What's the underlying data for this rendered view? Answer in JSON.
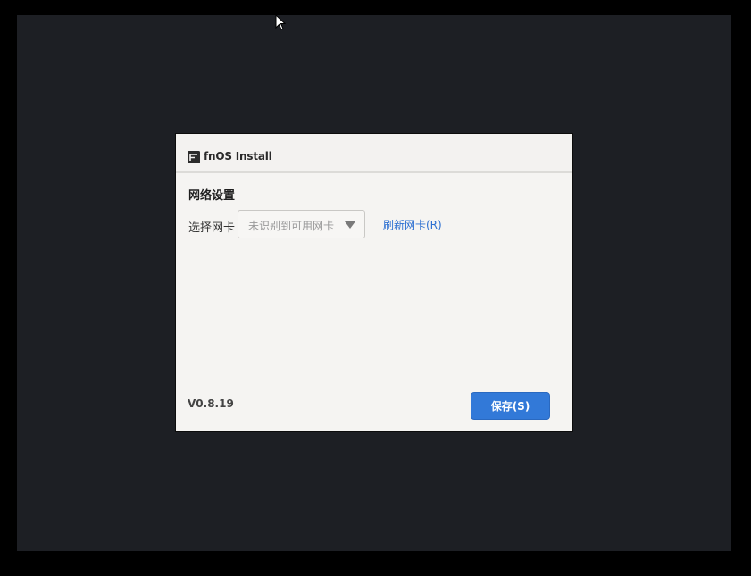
{
  "window": {
    "title": "fnOS Install",
    "icon": "fnos-logo-icon"
  },
  "network": {
    "heading": "网络设置",
    "select_label": "选择网卡",
    "select_value": "未识别到可用网卡",
    "refresh_link": "刷新网卡(R)"
  },
  "footer": {
    "version": "V0.8.19",
    "save_label": "保存(S)"
  },
  "colors": {
    "desktop_background": "#1d1f24",
    "dialog_background": "#f5f4f2",
    "accent": "#3279d8",
    "link": "#2c6fd1"
  }
}
